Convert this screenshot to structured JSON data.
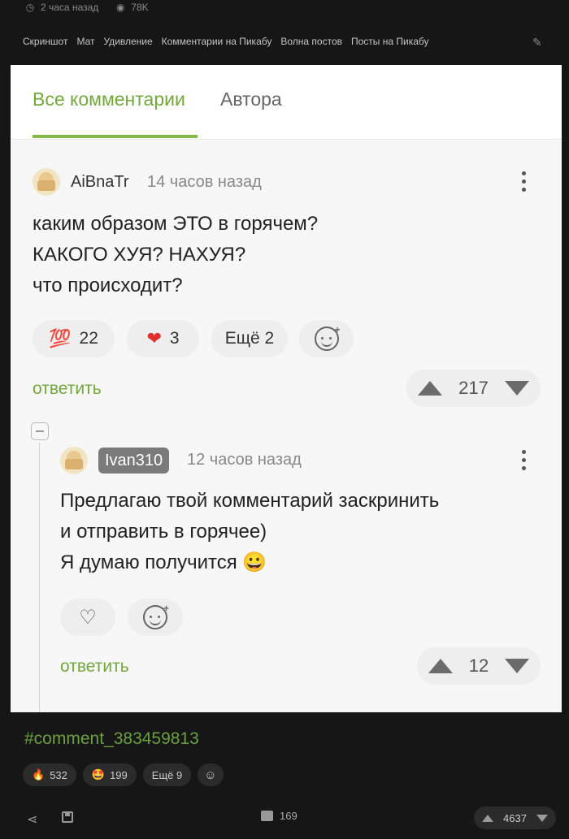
{
  "post_meta": {
    "time_icon": "clock-icon",
    "time": "2 часа назад",
    "views_icon": "eye-icon",
    "views": "78K"
  },
  "tags": [
    "Скриншот",
    "Мат",
    "Удивление",
    "Комментарии на Пикабу",
    "Волна постов",
    "Посты на Пикабу"
  ],
  "screenshot": {
    "tabs": {
      "all": "Все комментарии",
      "author": "Автора"
    },
    "comment1": {
      "user": "AiBnaTr",
      "time": "14 часов назад",
      "lines": [
        "каким образом ЭТО в горячем?",
        "КАКОГО ХУЯ? НАХУЯ?",
        "что происходит?"
      ],
      "reactions": [
        {
          "emoji": "💯",
          "count": "22"
        },
        {
          "emoji": "❤",
          "count": "3"
        }
      ],
      "more": "Ещё 2",
      "reply": "ответить",
      "rating": "217"
    },
    "comment2": {
      "user": "Ivan310",
      "time": "12 часов назад",
      "lines": [
        "Предлагаю твой комментарий заскринить",
        "и отправить в горячее)",
        "Я думаю получится 😀"
      ],
      "reply": "ответить",
      "rating": "12"
    }
  },
  "hashtag": "#comment_383459813",
  "reactions": [
    {
      "emoji": "🔥",
      "count": "532"
    },
    {
      "emoji": "🤩",
      "count": "199"
    }
  ],
  "reactions_more": "Ещё 9",
  "footer": {
    "comments": "169",
    "rating": "4637"
  },
  "colors": {
    "accent": "#72a93a",
    "background": "#161616"
  }
}
